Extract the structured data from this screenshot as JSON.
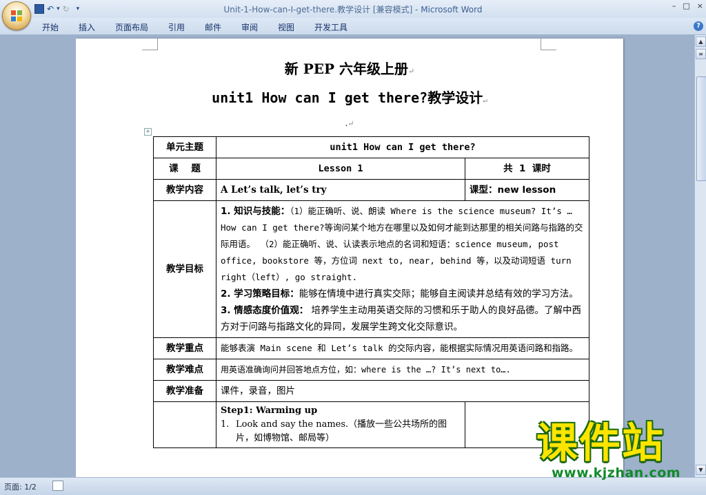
{
  "window": {
    "title": "Unit-1-How-can-I-get-there.教学设计 [兼容模式] - ",
    "app_name": "Microsoft Word",
    "controls": [
      "–",
      "□",
      "×"
    ]
  },
  "qat": {
    "save_icon": "save-icon",
    "undo_symbol": "↶",
    "undo_arrow": "▾",
    "redo_symbol": "↻",
    "customize": "▾"
  },
  "ribbon": {
    "tabs": [
      "开始",
      "插入",
      "页面布局",
      "引用",
      "邮件",
      "审阅",
      "视图",
      "开发工具"
    ],
    "help": "?"
  },
  "doc": {
    "title1": "新 PEP 六年级上册",
    "title2": "unit1 How can I get there?教学设计",
    "para_mark": "↵",
    "dot": "."
  },
  "table": {
    "row1": {
      "label": "单元主题",
      "value": "unit1 How can I get there?"
    },
    "row2": {
      "label": "课    题",
      "value": "Lesson 1",
      "hours": "共  1  课时"
    },
    "row3": {
      "label": "教学内容",
      "value": "A Let’s talk, let’s try",
      "type": "课型：new lesson"
    },
    "row4": {
      "label": "教学目标",
      "goal1_head": "1. 知识与技能：",
      "goal1_text": "（1）能正确听、说、朗读 Where is the science museum? It’s …How can I get there?等询问某个地方在哪里以及如何才能到达那里的相关问路与指路的交际用语。 （2）能正确听、说、认读表示地点的名词和短语：science museum, post office, bookstore 等，方位词 next to, near, behind 等，以及动词短语 turn right（left）, go straight.",
      "goal2_head": "2. 学习策略目标：",
      "goal2_text": "能够在情境中进行真实交际；能够自主阅读并总结有效的学习方法。",
      "goal3_head": "3. 情感态度价值观：",
      "goal3_text": " 培养学生主动用英语交际的习惯和乐于助人的良好品德。了解中西方对于问路与指路文化的异同，发展学生跨文化交际意识。"
    },
    "row5": {
      "label": "教学重点",
      "value": "能够表演 Main scene 和 Let’s talk 的交际内容，能根据实际情况用英语问路和指路。"
    },
    "row6": {
      "label": "教学难点",
      "value": "用英语准确询问并回答地点方位，如：where is the …? It’s next to…."
    },
    "row7": {
      "label": "教学准备",
      "value": "课件，录音，图片"
    },
    "row8": {
      "step_title": "Step1: Warming up",
      "step_item_num": "1.",
      "step_item": "Look and say the names.（播放一些公共场所的图片，如博物馆、邮局等）"
    }
  },
  "status": {
    "page": "页面: 1/2"
  },
  "watermark": {
    "brand": "课件站",
    "url": "www.kjzhan.com"
  }
}
